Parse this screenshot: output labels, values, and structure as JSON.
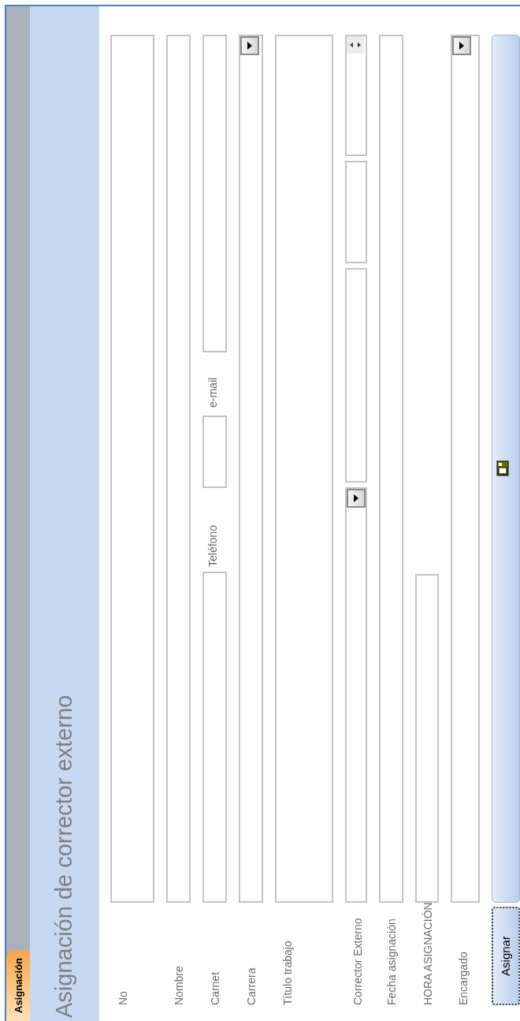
{
  "tab": {
    "label": "Asignación",
    "selected": true
  },
  "title": "Asignación de corrector externo",
  "rows": [
    {
      "label": "No",
      "kind": "large"
    },
    {
      "label": "Nombre",
      "kind": "text"
    },
    {
      "label": "Carnet",
      "kind": "contact",
      "extra_labels": [
        "Teléfono",
        "e-mail"
      ]
    },
    {
      "label": "Carrera",
      "kind": "combo"
    },
    {
      "label": "Título trabajo",
      "kind": "memo"
    },
    {
      "label": "Corrector Externo",
      "kind": "corrector"
    },
    {
      "label": "Fecha asignación",
      "kind": "text"
    },
    {
      "label": "HORA ASIGNACIÓN",
      "kind": "short"
    },
    {
      "label": "Encargado",
      "kind": "combo_tall"
    }
  ],
  "buttons": [
    {
      "kind": "text",
      "label": "Asignar",
      "focused": true
    },
    {
      "kind": "icon",
      "focused": false
    }
  ]
}
